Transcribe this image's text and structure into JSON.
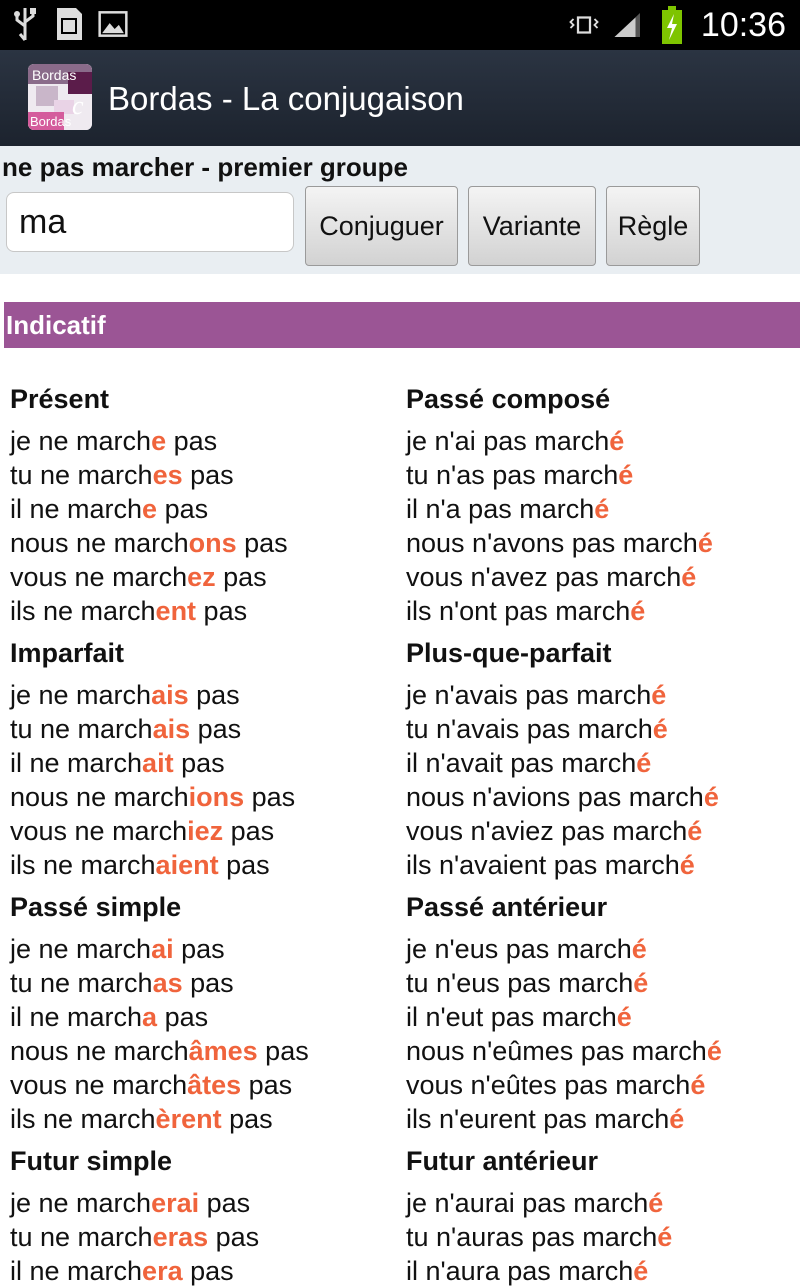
{
  "status_bar": {
    "time": "10:36",
    "left_icons": [
      "usb-icon",
      "sd-card-icon",
      "image-icon"
    ],
    "right_icons": [
      "vibrate-icon",
      "signal-icon",
      "battery-charging-icon"
    ]
  },
  "app": {
    "title": "Bordas - La conjugaison",
    "icon_text_top": "Bordas",
    "icon_text_bottom": "Bordas",
    "icon_letter": "c"
  },
  "search": {
    "verb_title": "ne pas marcher - premier groupe",
    "input_value": "ma",
    "buttons": [
      "Conjuguer",
      "Variante",
      "Règle"
    ]
  },
  "mode": "Indicatif",
  "colors": {
    "accent": "#9b5595",
    "ending": "#f0643c",
    "actionbar": "#1f2732"
  },
  "tenses": [
    {
      "name": "Présent",
      "lines": [
        [
          "je ne march",
          "e",
          " pas"
        ],
        [
          "tu ne march",
          "es",
          " pas"
        ],
        [
          "il ne march",
          "e",
          " pas"
        ],
        [
          "nous ne march",
          "ons",
          " pas"
        ],
        [
          "vous ne march",
          "ez",
          " pas"
        ],
        [
          "ils ne march",
          "ent",
          " pas"
        ]
      ]
    },
    {
      "name": "Passé composé",
      "lines": [
        [
          "je n'ai pas march",
          "é",
          ""
        ],
        [
          "tu n'as pas march",
          "é",
          ""
        ],
        [
          "il n'a pas march",
          "é",
          ""
        ],
        [
          "nous n'avons pas march",
          "é",
          ""
        ],
        [
          "vous n'avez pas march",
          "é",
          ""
        ],
        [
          "ils n'ont pas march",
          "é",
          ""
        ]
      ]
    },
    {
      "name": "Imparfait",
      "lines": [
        [
          "je ne march",
          "ais",
          " pas"
        ],
        [
          "tu ne march",
          "ais",
          " pas"
        ],
        [
          "il ne march",
          "ait",
          " pas"
        ],
        [
          "nous ne march",
          "ions",
          " pas"
        ],
        [
          "vous ne march",
          "iez",
          " pas"
        ],
        [
          "ils ne march",
          "aient",
          " pas"
        ]
      ]
    },
    {
      "name": "Plus-que-parfait",
      "lines": [
        [
          "je n'avais pas march",
          "é",
          ""
        ],
        [
          "tu n'avais pas march",
          "é",
          ""
        ],
        [
          "il n'avait pas march",
          "é",
          ""
        ],
        [
          "nous n'avions pas march",
          "é",
          ""
        ],
        [
          "vous n'aviez pas march",
          "é",
          ""
        ],
        [
          "ils n'avaient pas march",
          "é",
          ""
        ]
      ]
    },
    {
      "name": "Passé simple",
      "lines": [
        [
          "je ne march",
          "ai",
          " pas"
        ],
        [
          "tu ne march",
          "as",
          " pas"
        ],
        [
          "il ne march",
          "a",
          " pas"
        ],
        [
          "nous ne march",
          "âmes",
          " pas"
        ],
        [
          "vous ne march",
          "âtes",
          " pas"
        ],
        [
          "ils ne march",
          "èrent",
          " pas"
        ]
      ]
    },
    {
      "name": "Passé antérieur",
      "lines": [
        [
          "je n'eus pas march",
          "é",
          ""
        ],
        [
          "tu n'eus pas march",
          "é",
          ""
        ],
        [
          "il n'eut pas march",
          "é",
          ""
        ],
        [
          "nous n'eûmes pas march",
          "é",
          ""
        ],
        [
          "vous n'eûtes pas march",
          "é",
          ""
        ],
        [
          "ils n'eurent pas march",
          "é",
          ""
        ]
      ]
    },
    {
      "name": "Futur simple",
      "lines": [
        [
          "je ne march",
          "erai",
          " pas"
        ],
        [
          "tu ne march",
          "eras",
          " pas"
        ],
        [
          "il ne march",
          "era",
          " pas"
        ]
      ]
    },
    {
      "name": "Futur antérieur",
      "lines": [
        [
          "je n'aurai pas march",
          "é",
          ""
        ],
        [
          "tu n'auras pas march",
          "é",
          ""
        ],
        [
          "il n'aura pas march",
          "é",
          ""
        ]
      ]
    }
  ]
}
